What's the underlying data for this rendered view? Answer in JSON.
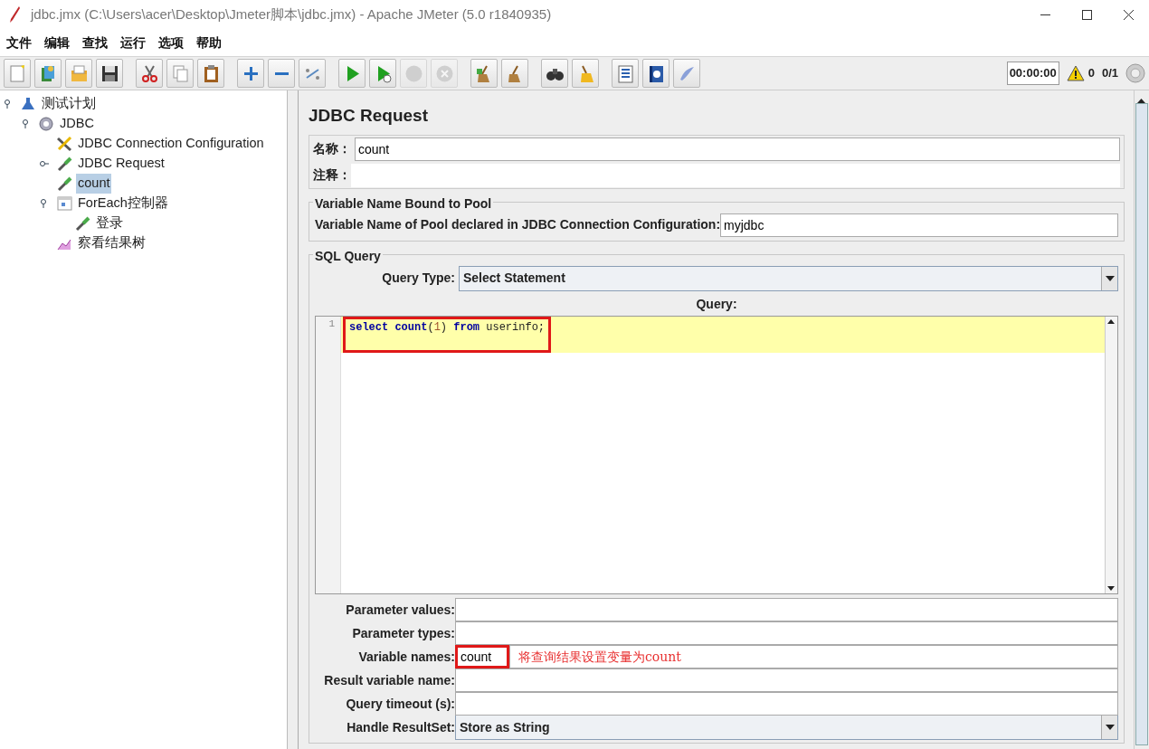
{
  "window": {
    "title": "jdbc.jmx (C:\\Users\\acer\\Desktop\\Jmeter脚本\\jdbc.jmx) - Apache JMeter (5.0 r1840935)"
  },
  "menu": [
    "文件",
    "编辑",
    "查找",
    "运行",
    "选项",
    "帮助"
  ],
  "toolbar_groups": [
    {
      "buttons": [
        {
          "kind": "new",
          "disabled": false
        },
        {
          "kind": "templates",
          "disabled": false
        },
        {
          "kind": "open",
          "disabled": false
        },
        {
          "kind": "save",
          "disabled": false
        }
      ]
    },
    {
      "buttons": [
        {
          "kind": "cut",
          "disabled": false
        },
        {
          "kind": "copy",
          "disabled": false
        },
        {
          "kind": "paste",
          "disabled": false
        }
      ]
    },
    {
      "buttons": [
        {
          "kind": "expand",
          "disabled": false
        },
        {
          "kind": "collapse",
          "disabled": false
        },
        {
          "kind": "toggle",
          "disabled": false
        }
      ]
    },
    {
      "buttons": [
        {
          "kind": "start",
          "disabled": false
        },
        {
          "kind": "start-nopause",
          "disabled": false
        },
        {
          "kind": "stop",
          "disabled": true
        },
        {
          "kind": "shutdown",
          "disabled": true
        }
      ]
    },
    {
      "buttons": [
        {
          "kind": "clear",
          "disabled": false
        },
        {
          "kind": "clear-all",
          "disabled": false
        }
      ]
    },
    {
      "buttons": [
        {
          "kind": "search",
          "disabled": false
        },
        {
          "kind": "reset-search",
          "disabled": false
        }
      ]
    },
    {
      "buttons": [
        {
          "kind": "functions",
          "disabled": false
        },
        {
          "kind": "help",
          "disabled": false
        },
        {
          "kind": "log",
          "disabled": false
        }
      ]
    }
  ],
  "status": {
    "timer": "00:00:00",
    "warnings": "0",
    "threads": "0/1"
  },
  "tree": [
    {
      "label": "测试计划",
      "kind": "plan",
      "selected": false,
      "expanded": true,
      "children": [
        {
          "label": "JDBC",
          "kind": "thread-group",
          "selected": false,
          "expanded": true,
          "children": [
            {
              "label": "JDBC Connection Configuration",
              "kind": "config",
              "selected": false
            },
            {
              "label": "JDBC Request",
              "kind": "sampler",
              "selected": false,
              "expanded": false
            },
            {
              "label": "count",
              "kind": "sampler",
              "selected": true
            },
            {
              "label": "ForEach控制器",
              "kind": "controller",
              "selected": false,
              "expanded": true,
              "children": [
                {
                  "label": "登录",
                  "kind": "sampler",
                  "selected": false
                }
              ]
            },
            {
              "label": "察看结果树",
              "kind": "listener",
              "selected": false
            }
          ]
        }
      ]
    }
  ],
  "panel": {
    "title": "JDBC Request",
    "name_label": "名称：",
    "name_value": "count",
    "comment_label": "注释：",
    "pool_group": {
      "legend": "Variable Name Bound to Pool",
      "label": "Variable Name of Pool declared in JDBC Connection Configuration:",
      "value": "myjdbc"
    },
    "sql_group": {
      "legend": "SQL Query",
      "query_type_label": "Query Type:",
      "query_type": "Select Statement",
      "query_label": "Query:",
      "lines": [
        {
          "number": "1",
          "highlighted": true,
          "tokens": [
            {
              "text": "select ",
              "kind": "keyword"
            },
            {
              "text": "count",
              "kind": "keyword"
            },
            {
              "text": "(",
              "kind": "plain"
            },
            {
              "text": "1",
              "kind": "number"
            },
            {
              "text": ") ",
              "kind": "plain"
            },
            {
              "text": "from",
              "kind": "keyword"
            },
            {
              "text": " userinfo;",
              "kind": "plain"
            }
          ]
        }
      ]
    },
    "params": [
      {
        "label": "Parameter values:",
        "kind": "text",
        "highlighted": false
      },
      {
        "label": "Parameter types:",
        "kind": "text",
        "highlighted": false
      },
      {
        "label": "Variable names:",
        "kind": "text",
        "value": "count",
        "highlighted": true,
        "annotation": "将查询结果设置变量为count"
      },
      {
        "label": "Result variable name:",
        "kind": "text",
        "highlighted": false
      },
      {
        "label": "Query timeout (s):",
        "kind": "text",
        "highlighted": false
      },
      {
        "label": "Handle ResultSet:",
        "kind": "select",
        "value": "Store as String",
        "highlighted": false
      }
    ]
  }
}
